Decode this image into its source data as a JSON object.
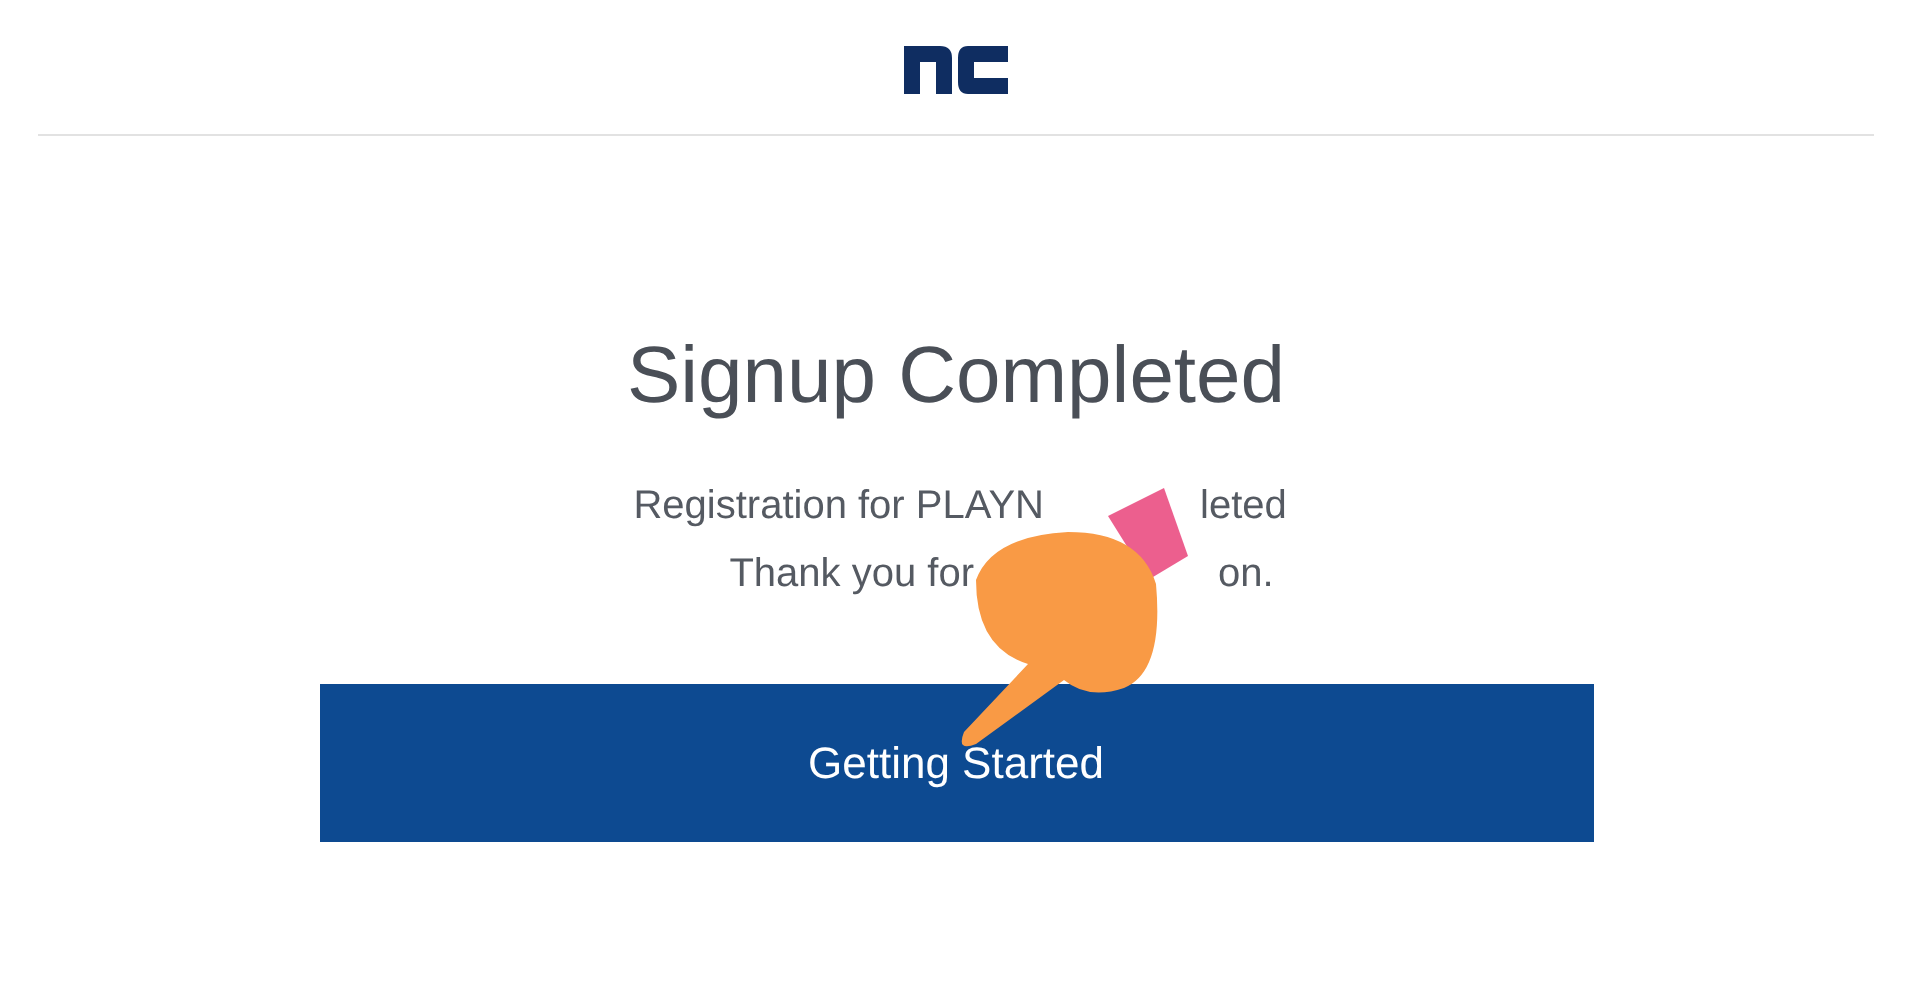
{
  "heading": "Signup Completed",
  "message_lines": [
    {
      "before": "Registration for PLAYN",
      "after": "leted"
    },
    {
      "before": "Thank you for",
      "after": "on."
    }
  ],
  "button": {
    "label": "Getting Started"
  }
}
